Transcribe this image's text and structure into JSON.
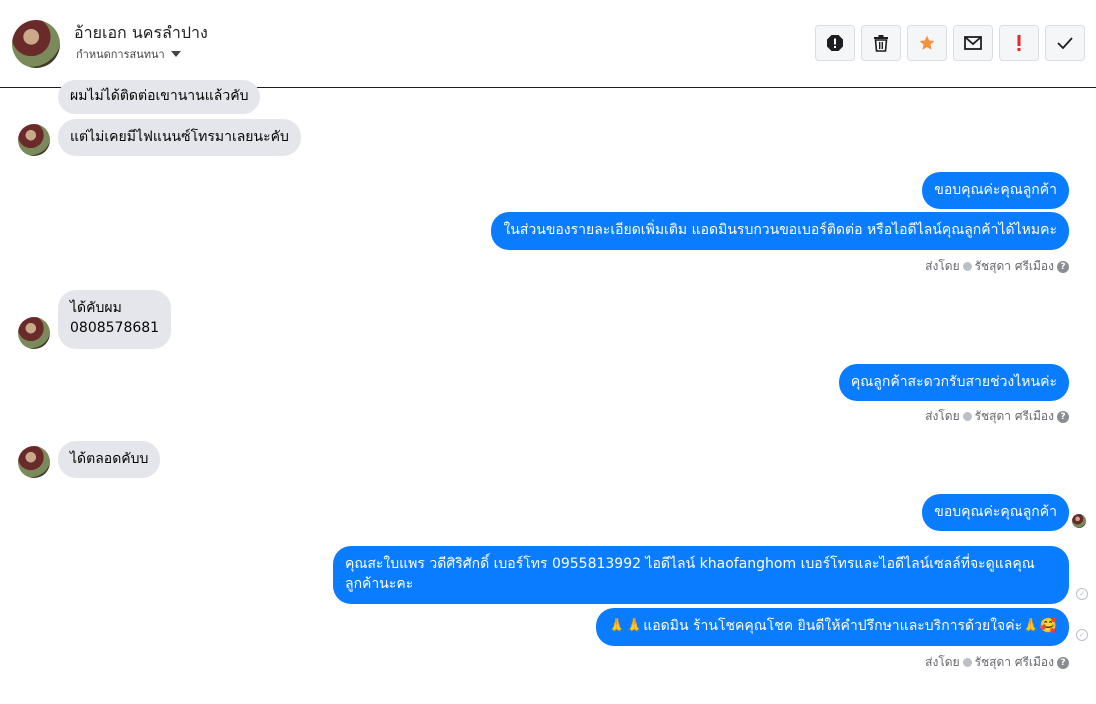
{
  "header": {
    "contact_name": "อ้ายเอก นครลำปาง",
    "subtitle": "กำหนดการสนทนา",
    "toolbar": [
      {
        "icon": "spam-icon"
      },
      {
        "icon": "trash-icon"
      },
      {
        "icon": "star-icon"
      },
      {
        "icon": "mail-icon"
      },
      {
        "icon": "alert-icon"
      },
      {
        "icon": "check-icon"
      }
    ]
  },
  "messages": {
    "in_1": "ผมไม่ได้ติดต่อเขานานแล้วคับ",
    "in_2": "แต่ไม่เคยมีไฟแนนซ์โทรมาเลยนะคับ",
    "out_1": "ขอบคุณค่ะคุณลูกค้า",
    "out_2": "ในส่วนของรายละเอียดเพิ่มเติม แอดมินรบกวนขอเบอร์ติดต่อ หรือไอดีไลน์คุณลูกค้าได้ไหมคะ",
    "in_3_line1": "ได้คับผม",
    "in_3_line2": "0808578681",
    "out_3": "คุณลูกค้าสะดวกรับสายช่วงไหนค่ะ",
    "in_4": "ได้ตลอดคับบ",
    "out_4": "ขอบคุณค่ะคุณลูกค้า",
    "out_5": "คุณสะใบแพร วดีศิริศักดิ์ เบอร์โทร 0955813992  ไอดีไลน์  khaofanghom   เบอร์โทรและไอดีไลน์เซลล์ที่จะดูแลคุณลูกค้านะคะ",
    "out_6": "🙏🙏แอดมิน ร้านโชคคุณโชค ยินดีให้คำปรึกษาและบริการด้วยใจค่ะ🙏🥰"
  },
  "sent_by": {
    "label": "ส่งโดย",
    "name": "รัชสุดา ศรีเมือง"
  },
  "colors": {
    "outgoing_bubble": "#0a7cff",
    "incoming_bubble": "#e4e6eb",
    "star": "#f7923a",
    "alert": "#e4262c"
  }
}
